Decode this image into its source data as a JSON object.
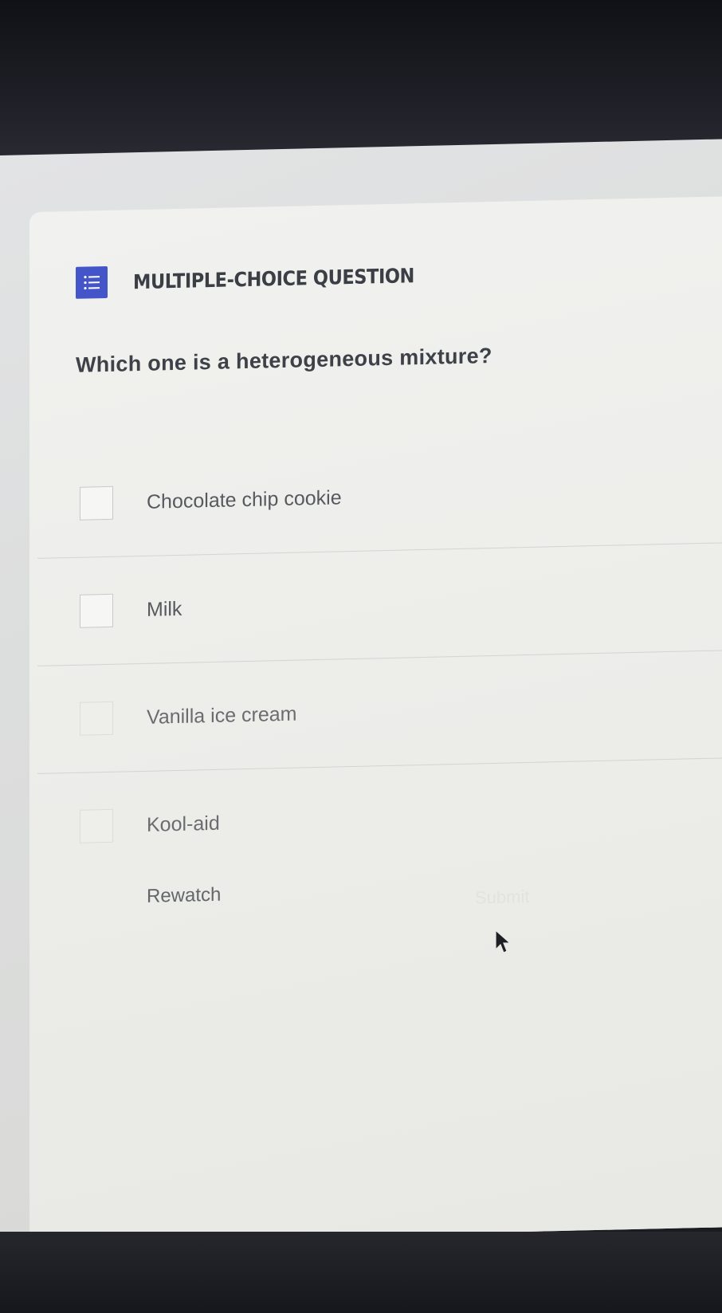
{
  "question_card": {
    "type_label": "MULTIPLE-CHOICE QUESTION",
    "type_icon": "list-icon",
    "question": "Which one is a heterogeneous mixture?",
    "options": [
      {
        "label": "Chocolate chip cookie",
        "checked": false
      },
      {
        "label": "Milk",
        "checked": false
      },
      {
        "label": "Vanilla ice cream",
        "checked": false
      },
      {
        "label": "Kool-aid",
        "checked": false
      }
    ],
    "rewatch_label": "Rewatch",
    "submit_label": "Submit",
    "accent_color": "#4355c8"
  }
}
